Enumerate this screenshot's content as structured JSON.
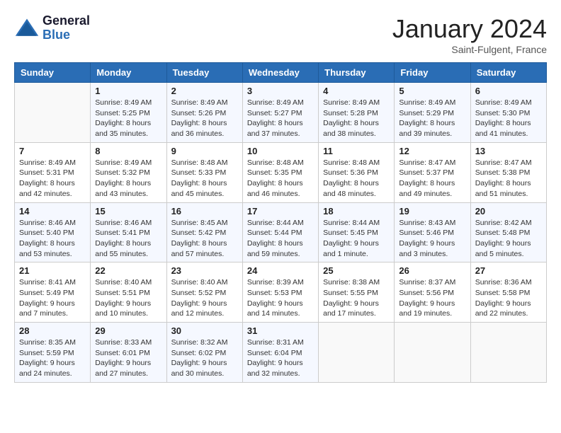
{
  "header": {
    "logo_general": "General",
    "logo_blue": "Blue",
    "month": "January 2024",
    "location": "Saint-Fulgent, France"
  },
  "weekdays": [
    "Sunday",
    "Monday",
    "Tuesday",
    "Wednesday",
    "Thursday",
    "Friday",
    "Saturday"
  ],
  "weeks": [
    [
      {
        "day": "",
        "sunrise": "",
        "sunset": "",
        "daylight": ""
      },
      {
        "day": "1",
        "sunrise": "Sunrise: 8:49 AM",
        "sunset": "Sunset: 5:25 PM",
        "daylight": "Daylight: 8 hours and 35 minutes."
      },
      {
        "day": "2",
        "sunrise": "Sunrise: 8:49 AM",
        "sunset": "Sunset: 5:26 PM",
        "daylight": "Daylight: 8 hours and 36 minutes."
      },
      {
        "day": "3",
        "sunrise": "Sunrise: 8:49 AM",
        "sunset": "Sunset: 5:27 PM",
        "daylight": "Daylight: 8 hours and 37 minutes."
      },
      {
        "day": "4",
        "sunrise": "Sunrise: 8:49 AM",
        "sunset": "Sunset: 5:28 PM",
        "daylight": "Daylight: 8 hours and 38 minutes."
      },
      {
        "day": "5",
        "sunrise": "Sunrise: 8:49 AM",
        "sunset": "Sunset: 5:29 PM",
        "daylight": "Daylight: 8 hours and 39 minutes."
      },
      {
        "day": "6",
        "sunrise": "Sunrise: 8:49 AM",
        "sunset": "Sunset: 5:30 PM",
        "daylight": "Daylight: 8 hours and 41 minutes."
      }
    ],
    [
      {
        "day": "7",
        "sunrise": "Sunrise: 8:49 AM",
        "sunset": "Sunset: 5:31 PM",
        "daylight": "Daylight: 8 hours and 42 minutes."
      },
      {
        "day": "8",
        "sunrise": "Sunrise: 8:49 AM",
        "sunset": "Sunset: 5:32 PM",
        "daylight": "Daylight: 8 hours and 43 minutes."
      },
      {
        "day": "9",
        "sunrise": "Sunrise: 8:48 AM",
        "sunset": "Sunset: 5:33 PM",
        "daylight": "Daylight: 8 hours and 45 minutes."
      },
      {
        "day": "10",
        "sunrise": "Sunrise: 8:48 AM",
        "sunset": "Sunset: 5:35 PM",
        "daylight": "Daylight: 8 hours and 46 minutes."
      },
      {
        "day": "11",
        "sunrise": "Sunrise: 8:48 AM",
        "sunset": "Sunset: 5:36 PM",
        "daylight": "Daylight: 8 hours and 48 minutes."
      },
      {
        "day": "12",
        "sunrise": "Sunrise: 8:47 AM",
        "sunset": "Sunset: 5:37 PM",
        "daylight": "Daylight: 8 hours and 49 minutes."
      },
      {
        "day": "13",
        "sunrise": "Sunrise: 8:47 AM",
        "sunset": "Sunset: 5:38 PM",
        "daylight": "Daylight: 8 hours and 51 minutes."
      }
    ],
    [
      {
        "day": "14",
        "sunrise": "Sunrise: 8:46 AM",
        "sunset": "Sunset: 5:40 PM",
        "daylight": "Daylight: 8 hours and 53 minutes."
      },
      {
        "day": "15",
        "sunrise": "Sunrise: 8:46 AM",
        "sunset": "Sunset: 5:41 PM",
        "daylight": "Daylight: 8 hours and 55 minutes."
      },
      {
        "day": "16",
        "sunrise": "Sunrise: 8:45 AM",
        "sunset": "Sunset: 5:42 PM",
        "daylight": "Daylight: 8 hours and 57 minutes."
      },
      {
        "day": "17",
        "sunrise": "Sunrise: 8:44 AM",
        "sunset": "Sunset: 5:44 PM",
        "daylight": "Daylight: 8 hours and 59 minutes."
      },
      {
        "day": "18",
        "sunrise": "Sunrise: 8:44 AM",
        "sunset": "Sunset: 5:45 PM",
        "daylight": "Daylight: 9 hours and 1 minute."
      },
      {
        "day": "19",
        "sunrise": "Sunrise: 8:43 AM",
        "sunset": "Sunset: 5:46 PM",
        "daylight": "Daylight: 9 hours and 3 minutes."
      },
      {
        "day": "20",
        "sunrise": "Sunrise: 8:42 AM",
        "sunset": "Sunset: 5:48 PM",
        "daylight": "Daylight: 9 hours and 5 minutes."
      }
    ],
    [
      {
        "day": "21",
        "sunrise": "Sunrise: 8:41 AM",
        "sunset": "Sunset: 5:49 PM",
        "daylight": "Daylight: 9 hours and 7 minutes."
      },
      {
        "day": "22",
        "sunrise": "Sunrise: 8:40 AM",
        "sunset": "Sunset: 5:51 PM",
        "daylight": "Daylight: 9 hours and 10 minutes."
      },
      {
        "day": "23",
        "sunrise": "Sunrise: 8:40 AM",
        "sunset": "Sunset: 5:52 PM",
        "daylight": "Daylight: 9 hours and 12 minutes."
      },
      {
        "day": "24",
        "sunrise": "Sunrise: 8:39 AM",
        "sunset": "Sunset: 5:53 PM",
        "daylight": "Daylight: 9 hours and 14 minutes."
      },
      {
        "day": "25",
        "sunrise": "Sunrise: 8:38 AM",
        "sunset": "Sunset: 5:55 PM",
        "daylight": "Daylight: 9 hours and 17 minutes."
      },
      {
        "day": "26",
        "sunrise": "Sunrise: 8:37 AM",
        "sunset": "Sunset: 5:56 PM",
        "daylight": "Daylight: 9 hours and 19 minutes."
      },
      {
        "day": "27",
        "sunrise": "Sunrise: 8:36 AM",
        "sunset": "Sunset: 5:58 PM",
        "daylight": "Daylight: 9 hours and 22 minutes."
      }
    ],
    [
      {
        "day": "28",
        "sunrise": "Sunrise: 8:35 AM",
        "sunset": "Sunset: 5:59 PM",
        "daylight": "Daylight: 9 hours and 24 minutes."
      },
      {
        "day": "29",
        "sunrise": "Sunrise: 8:33 AM",
        "sunset": "Sunset: 6:01 PM",
        "daylight": "Daylight: 9 hours and 27 minutes."
      },
      {
        "day": "30",
        "sunrise": "Sunrise: 8:32 AM",
        "sunset": "Sunset: 6:02 PM",
        "daylight": "Daylight: 9 hours and 30 minutes."
      },
      {
        "day": "31",
        "sunrise": "Sunrise: 8:31 AM",
        "sunset": "Sunset: 6:04 PM",
        "daylight": "Daylight: 9 hours and 32 minutes."
      },
      {
        "day": "",
        "sunrise": "",
        "sunset": "",
        "daylight": ""
      },
      {
        "day": "",
        "sunrise": "",
        "sunset": "",
        "daylight": ""
      },
      {
        "day": "",
        "sunrise": "",
        "sunset": "",
        "daylight": ""
      }
    ]
  ]
}
